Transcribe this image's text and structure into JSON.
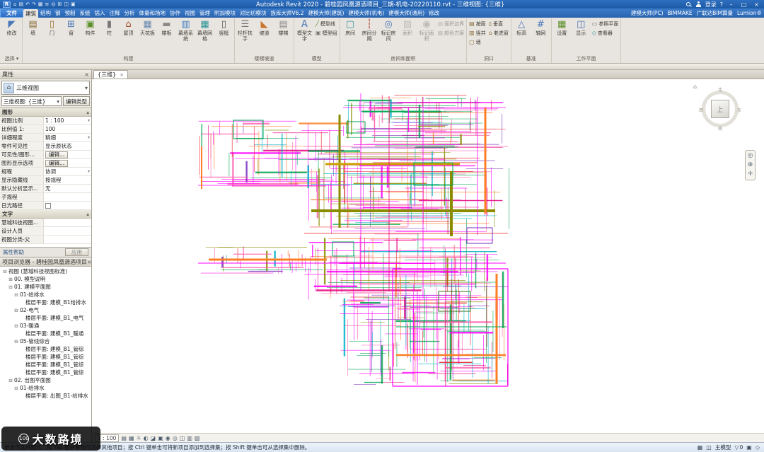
{
  "titlebar": {
    "app_title": "Autodesk Revit 2020 - 碧桂园凤凰源酒项目_三期-机电-20220110.rvt - 三维视图: {三维}",
    "login_label": "登录",
    "help_label": "?",
    "qat_icons": [
      {
        "name": "open-icon",
        "glyph": "⌂"
      },
      {
        "name": "save-icon",
        "glyph": "▤"
      },
      {
        "name": "undo-icon",
        "glyph": "↶"
      },
      {
        "name": "redo-icon",
        "glyph": "↷"
      },
      {
        "name": "print-icon",
        "glyph": "▦"
      },
      {
        "name": "measure-icon",
        "glyph": "≡"
      },
      {
        "name": "tag-icon",
        "glyph": "◎"
      },
      {
        "name": "3d-view-icon",
        "glyph": "⊞"
      },
      {
        "name": "section-icon",
        "glyph": "◫"
      },
      {
        "name": "thin-lines-icon",
        "glyph": "▣"
      }
    ],
    "window_buttons": {
      "minimize": "–",
      "maximize": "□",
      "close": "×"
    }
  },
  "ribbon": {
    "file_tab": "文件",
    "active_tab": "建筑",
    "tabs": [
      "建筑",
      "结构",
      "钢",
      "预制",
      "系统",
      "插入",
      "注释",
      "分析",
      "体量和场地",
      "协作",
      "视图",
      "管理",
      "附加模块",
      "对比切模块",
      "族库大师V6.2",
      "建模大师(建筑)",
      "建模大师(机电)",
      "建模大师(通用)",
      "修改"
    ],
    "right_tabs": [
      "建模大师(PC)",
      "BIMMAKE",
      "广联达BIM算量",
      "Lumion®"
    ],
    "groups": [
      {
        "label": "选择 ▾",
        "tools": [
          {
            "t": "修改",
            "g": "◤",
            "c": "#4a78b8",
            "big": true,
            "icon": "modify-cursor-icon"
          }
        ]
      },
      {
        "label": "构建",
        "tools": [
          {
            "t": "墙",
            "g": "▤",
            "c": "#8a6d3b",
            "big": true,
            "icon": "wall-icon"
          },
          {
            "t": "门",
            "g": "▯",
            "c": "#9c6b30",
            "big": true,
            "icon": "door-icon"
          },
          {
            "t": "窗",
            "g": "⊞",
            "c": "#4a78b8",
            "big": true,
            "icon": "window-icon"
          },
          {
            "t": "构件",
            "g": "▣",
            "c": "#5a8f29",
            "big": true,
            "icon": "component-icon"
          },
          {
            "t": "柱",
            "g": "▮",
            "c": "#777777",
            "big": true,
            "icon": "column-icon"
          },
          {
            "t": "屋顶",
            "g": "⌂",
            "c": "#a0522d",
            "big": true,
            "icon": "roof-icon"
          },
          {
            "t": "天花板",
            "g": "▦",
            "c": "#6a8caf",
            "big": true,
            "icon": "ceiling-icon"
          },
          {
            "t": "楼板",
            "g": "▬",
            "c": "#8a8a8a",
            "big": true,
            "icon": "floor-icon"
          },
          {
            "t": "幕墙系统",
            "g": "▥",
            "c": "#3f7fbf",
            "big": true,
            "icon": "curtain-system-icon"
          },
          {
            "t": "幕墙网格",
            "g": "▦",
            "c": "#2e9599",
            "big": true,
            "icon": "curtain-grid-icon"
          },
          {
            "t": "竖梃",
            "g": "▯",
            "c": "#555555",
            "big": true,
            "icon": "mullion-icon"
          }
        ]
      },
      {
        "label": "楼梯坡道",
        "tools": [
          {
            "t": "栏杆扶手",
            "g": "☰",
            "c": "#777777",
            "big": true,
            "icon": "railing-icon"
          },
          {
            "t": "坡道",
            "g": "◣",
            "c": "#c8762c",
            "big": true,
            "icon": "ramp-icon"
          },
          {
            "t": "楼梯",
            "g": "▤",
            "c": "#8a8a8a",
            "big": true,
            "icon": "stair-icon"
          }
        ]
      },
      {
        "label": "模型",
        "tools": [
          {
            "t": "模型文字",
            "g": "A",
            "c": "#4a78b8",
            "big": true,
            "icon": "model-text-icon"
          },
          {
            "t": "模型线",
            "g": "╱",
            "c": "#5a8f29",
            "small": true,
            "icon": "model-line-icon"
          },
          {
            "t": "模型组",
            "g": "▣",
            "c": "#777777",
            "small": true,
            "icon": "model-group-icon"
          }
        ]
      },
      {
        "label": "房间和面积",
        "tools": [
          {
            "t": "房间",
            "g": "▢",
            "c": "#2e9599",
            "big": true,
            "icon": "room-icon"
          },
          {
            "t": "房间分隔",
            "g": "┆",
            "c": "#b23b2e",
            "big": true,
            "icon": "room-separator-icon"
          },
          {
            "t": "标记房间",
            "g": "◎",
            "c": "#4a78b8",
            "big": true,
            "icon": "tag-room-icon"
          },
          {
            "t": "面积",
            "g": "▨",
            "c": "#888888",
            "big": true,
            "disabled": true,
            "icon": "area-icon"
          },
          {
            "t": "标记面积",
            "g": "◉",
            "c": "#888888",
            "big": true,
            "disabled": true,
            "icon": "tag-area-icon"
          },
          {
            "t": "面积边界",
            "g": "▧",
            "c": "#888888",
            "small": true,
            "disabled": true,
            "icon": "area-boundary-icon"
          },
          {
            "t": "颜色方案",
            "g": "▩",
            "c": "#888888",
            "small": true,
            "disabled": true,
            "icon": "color-scheme-icon"
          }
        ]
      },
      {
        "label": "洞口",
        "tools": [
          {
            "t": "按面",
            "g": "▤",
            "c": "#8a6d3b",
            "small": true,
            "icon": "opening-by-face-icon"
          },
          {
            "t": "竖井",
            "g": "▥",
            "c": "#8a6d3b",
            "small": true,
            "icon": "shaft-opening-icon"
          },
          {
            "t": "墙",
            "g": "▢",
            "c": "#8a6d3b",
            "small": true,
            "icon": "wall-opening-icon"
          },
          {
            "t": "垂直",
            "g": "▯",
            "c": "#8a6d3b",
            "small": true,
            "icon": "vertical-opening-icon"
          },
          {
            "t": "老虎窗",
            "g": "⌂",
            "c": "#8a6d3b",
            "small": true,
            "icon": "dormer-opening-icon"
          }
        ]
      },
      {
        "label": "基准",
        "tools": [
          {
            "t": "标高",
            "g": "△",
            "c": "#4a78b8",
            "big": true,
            "icon": "level-icon"
          },
          {
            "t": "轴网",
            "g": "#",
            "c": "#4a78b8",
            "big": true,
            "icon": "grid-icon"
          }
        ]
      },
      {
        "label": "工作平面",
        "tools": [
          {
            "t": "设置",
            "g": "▦",
            "c": "#5a8f29",
            "big": true,
            "icon": "set-work-plane-icon"
          },
          {
            "t": "显示",
            "g": "◫",
            "c": "#4a78b8",
            "big": true,
            "icon": "show-work-plane-icon"
          },
          {
            "t": "参照平面",
            "g": "▭",
            "c": "#777777",
            "small": true,
            "icon": "reference-plane-icon"
          },
          {
            "t": "查看器",
            "g": "◇",
            "c": "#2e9599",
            "small": true,
            "icon": "viewer-icon"
          }
        ]
      }
    ]
  },
  "properties": {
    "title": "属性",
    "type_selector": "三维视图",
    "instance_label": "三维视图: {三维}",
    "edit_type_label": "编辑类型",
    "sections": [
      {
        "name": "图形",
        "rows": [
          {
            "label": "视图比例",
            "value": "1 : 100",
            "kind": "combo"
          },
          {
            "label": "比例值 1:",
            "value": "100",
            "kind": "text"
          },
          {
            "label": "详细程度",
            "value": "精细",
            "kind": "combo"
          },
          {
            "label": "零件可见性",
            "value": "显示原状态",
            "kind": "text"
          },
          {
            "label": "可见性/图形...",
            "value": "编辑...",
            "kind": "button"
          },
          {
            "label": "图形显示选项",
            "value": "编辑...",
            "kind": "button"
          },
          {
            "label": "规程",
            "value": "协调",
            "kind": "combo"
          },
          {
            "label": "显示隐藏线",
            "value": "按规程",
            "kind": "text"
          },
          {
            "label": "默认分析显示...",
            "value": "无",
            "kind": "text"
          },
          {
            "label": "子规程",
            "value": "",
            "kind": "text"
          },
          {
            "label": "日光路径",
            "value": "",
            "kind": "check"
          }
        ]
      },
      {
        "name": "文字",
        "rows": [
          {
            "label": "慧城科技视图...",
            "value": "",
            "kind": "text"
          },
          {
            "label": "设计人员",
            "value": "",
            "kind": "text"
          },
          {
            "label": "视图分类-父",
            "value": "",
            "kind": "text"
          }
        ]
      }
    ],
    "help_label": "属性帮助",
    "apply_label": "应用"
  },
  "browser": {
    "title": "项目浏览器 - 碧桂园凤凰源酒项目",
    "tree": [
      {
        "i": 0,
        "e": "⊟",
        "t": "视图 (慧城科技视图标准)"
      },
      {
        "i": 1,
        "e": "⊞",
        "t": "00. 模型说明"
      },
      {
        "i": 1,
        "e": "⊟",
        "t": "01. 建模平面图"
      },
      {
        "i": 2,
        "e": "⊟",
        "t": "01-给排水"
      },
      {
        "i": 3,
        "e": "",
        "t": "楼层平面: 建模_B1给排水"
      },
      {
        "i": 2,
        "e": "⊟",
        "t": "02-电气"
      },
      {
        "i": 3,
        "e": "",
        "t": "楼层平面: 建模_B1_电气"
      },
      {
        "i": 2,
        "e": "⊟",
        "t": "03-暖通"
      },
      {
        "i": 3,
        "e": "",
        "t": "楼层平面: 建模_B1_暖通"
      },
      {
        "i": 2,
        "e": "⊟",
        "t": "05-管线综合"
      },
      {
        "i": 3,
        "e": "",
        "t": "楼层平面: 建模_B1_管综"
      },
      {
        "i": 3,
        "e": "",
        "t": "楼层平面: 建模_B1_管综"
      },
      {
        "i": 3,
        "e": "",
        "t": "楼层平面: 建模_B1_管综"
      },
      {
        "i": 3,
        "e": "",
        "t": "楼层平面: 建模_B1_管综"
      },
      {
        "i": 1,
        "e": "⊟",
        "t": "02. 出图平面图"
      },
      {
        "i": 2,
        "e": "⊟",
        "t": "01-给排水"
      },
      {
        "i": 3,
        "e": "",
        "t": "楼层平面: 出图_B1-给排水"
      }
    ]
  },
  "canvas": {
    "view_tab": "{三维}",
    "view_tab_close": "×",
    "viewcube": {
      "home": "⌂",
      "top": "上",
      "north": "北",
      "east": "东",
      "south": "南",
      "west": "西"
    },
    "navbar_icons": [
      {
        "name": "steering-wheel-icon",
        "glyph": "◎"
      },
      {
        "name": "zoom-icon",
        "glyph": "⊕"
      },
      {
        "name": "pan-icon",
        "glyph": "✛"
      }
    ],
    "view_control": {
      "scale": "1 : 100",
      "icons": [
        {
          "name": "detail-level-icon",
          "glyph": "▤"
        },
        {
          "name": "visual-style-icon",
          "glyph": "▦"
        },
        {
          "name": "sun-path-icon",
          "glyph": "☼"
        },
        {
          "name": "shadows-icon",
          "glyph": "◐"
        },
        {
          "name": "rendering-icon",
          "glyph": "◪"
        },
        {
          "name": "crop-view-icon",
          "glyph": "▣"
        },
        {
          "name": "crop-region-icon",
          "glyph": "◉"
        },
        {
          "name": "temporary-hide-icon",
          "glyph": "◎"
        },
        {
          "name": "reveal-hidden-icon",
          "glyph": "◫"
        },
        {
          "name": "temporary-view-properties-icon",
          "glyph": "▥"
        },
        {
          "name": "constraints-icon",
          "glyph": "▧"
        }
      ]
    },
    "drawing_palette": [
      "#ff00ff",
      "#ff00ff",
      "#ff00ff",
      "#e6007e",
      "#ff69b4",
      "#ff69b4",
      "#00a651",
      "#00a651",
      "#ff7f27",
      "#ed1c24",
      "#8b8b00",
      "#00b0c8",
      "#7b2fbe"
    ]
  },
  "statusbar": {
    "prompt": "单击可选择图元，按 Tab 键并单击可选择其他项目；按 Ctrl 键单击可将新项目添加到选择集；按 Shift 键单击可从选择集中删除。",
    "left_icons": [
      {
        "name": "worksets-icon",
        "glyph": "◫"
      },
      {
        "name": "design-options-icon",
        "glyph": "▦"
      }
    ],
    "model_label": "主模型",
    "right_icons": [
      {
        "name": "editable-only-icon",
        "glyph": "▣"
      },
      {
        "name": "exclude-options-icon",
        "glyph": "◇"
      }
    ],
    "filter_icon": "▽",
    "filter_count": "0"
  },
  "watermark": {
    "badge": "100",
    "text": "大数路境"
  }
}
